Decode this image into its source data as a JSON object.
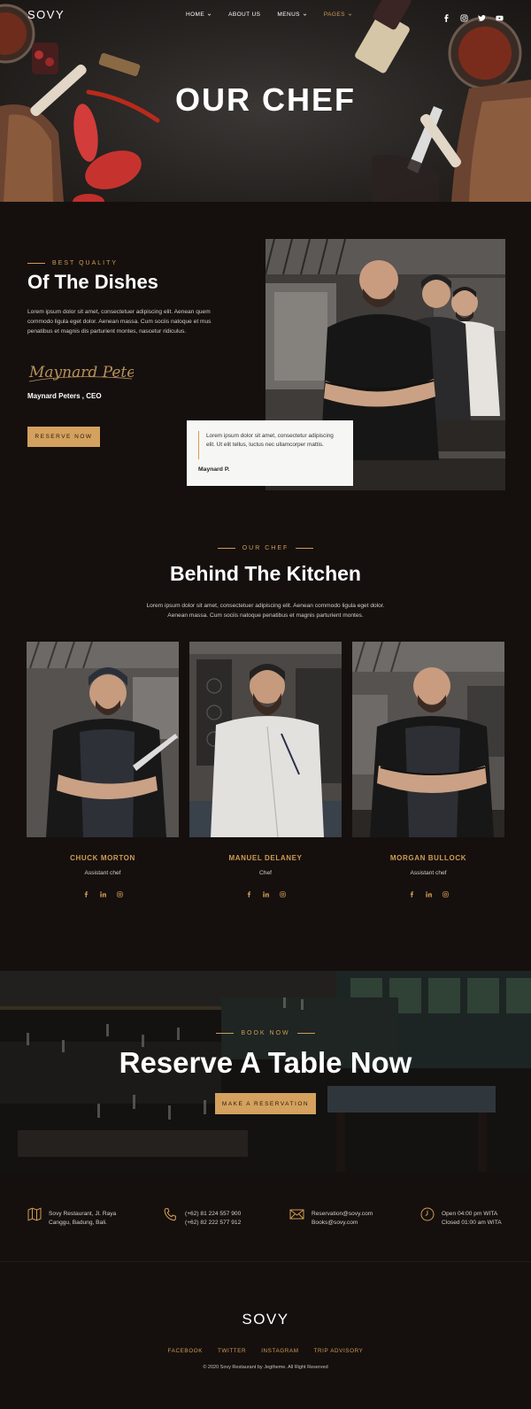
{
  "brand": {
    "logo": "SOVY"
  },
  "nav": {
    "items": [
      {
        "label": "HOME",
        "has_dropdown": true
      },
      {
        "label": "ABOUT US",
        "has_dropdown": false
      },
      {
        "label": "MENUS",
        "has_dropdown": true
      },
      {
        "label": "PAGES",
        "has_dropdown": true,
        "active": true
      }
    ],
    "socials": [
      "facebook-icon",
      "instagram-icon",
      "twitter-icon",
      "youtube-icon"
    ]
  },
  "hero": {
    "title": "OUR CHEF"
  },
  "about": {
    "eyebrow": "BEST QUALITY",
    "title": "Of The Dishes",
    "text": "Lorem ipsum dolor sit amet, consectetuer adipiscing elit. Aenean quem commodo ligula eget dolor. Aenean massa. Cum sociis natoque et mus penatibus et magnis dis parturient montes, nascetur ridiculus.",
    "signature": "Maynard Peters",
    "name": "Maynard Peters , CEO",
    "button": "RESERVE NOW",
    "quote": {
      "text": "Lorem ipsum dolor sit amet, consectetur adipiscing elit. Ut elit tellus, luctus nec ullamcorper mattis.",
      "author": "Maynard P."
    }
  },
  "team": {
    "eyebrow": "OUR CHEF",
    "title": "Behind The Kitchen",
    "text": "Lorem ipsum dolor sit amet, consectetuer adipiscing elit. Aenean commodo ligula eget dolor. Aenean massa. Cum sociis natoque penatibus et magnis parturient montes.",
    "members": [
      {
        "name": "CHUCK MORTON",
        "role": "Assistant chef"
      },
      {
        "name": "MANUEL DELANEY",
        "role": "Chef"
      },
      {
        "name": "MORGAN BULLOCK",
        "role": "Assistant chef"
      }
    ]
  },
  "reserve": {
    "eyebrow": "BOOK NOW",
    "title": "Reserve A Table Now",
    "button": "MAKE A RESERVATION"
  },
  "contact": [
    {
      "icon": "map-icon",
      "line1": "Sovy Restaurant, Jl. Raya",
      "line2": "Canggu, Badung, Bali."
    },
    {
      "icon": "phone-icon",
      "line1": "(+62) 81 224 557 900",
      "line2": "(+62) 82 222 577 912"
    },
    {
      "icon": "mail-icon",
      "line1": "Reservation@sovy.com",
      "line2": "Books@sovy.com"
    },
    {
      "icon": "clock-icon",
      "line1": "Open 04:00 pm WITA",
      "line2": "Closed 01:00 am WITA"
    }
  ],
  "footer": {
    "logo": "SOVY",
    "links": [
      "FACEBOOK",
      "TWITTER",
      "INSTAGRAM",
      "TRIP ADVISORY"
    ],
    "copyright": "© 2020 Sovy Restaurant by Jegtheme. All Right Reserved"
  },
  "colors": {
    "accent": "#d19b53",
    "button": "#d4a15e",
    "background": "#15100e"
  }
}
